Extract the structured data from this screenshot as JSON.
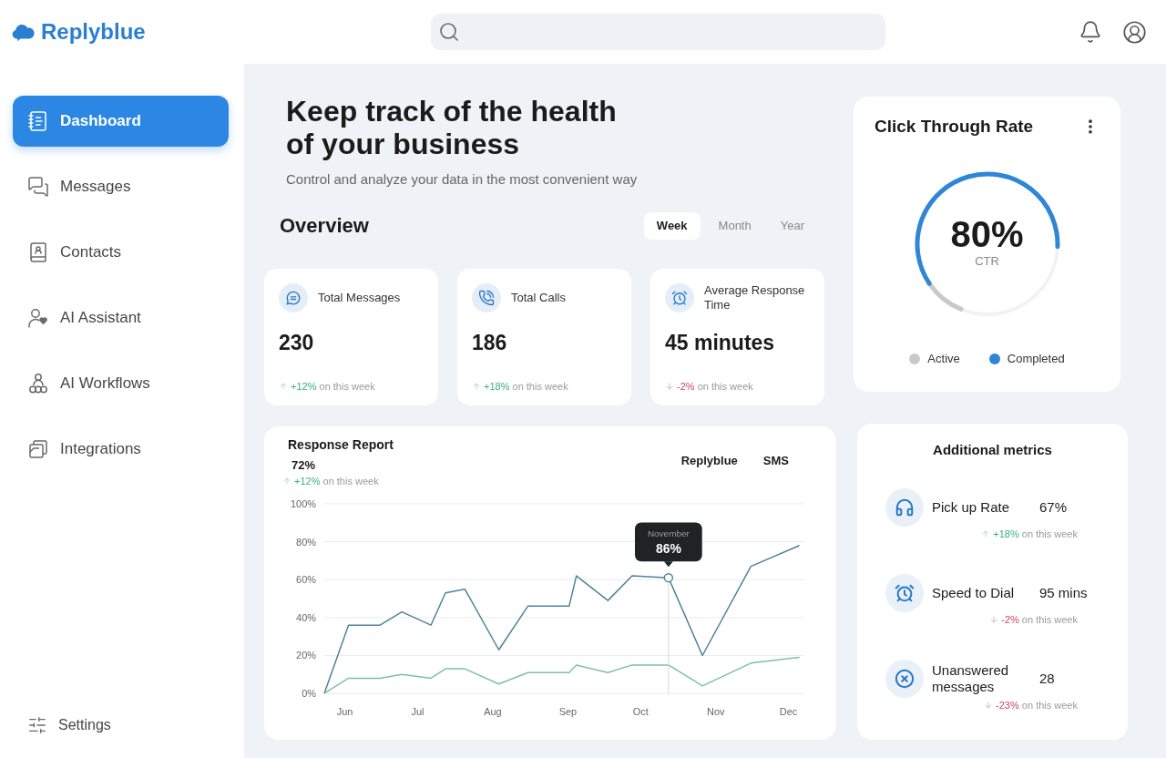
{
  "header": {
    "brand": "Replyblue"
  },
  "sidebar": {
    "items": [
      {
        "label": "Dashboard",
        "selected": true
      },
      {
        "label": "Messages",
        "selected": false
      },
      {
        "label": "Contacts",
        "selected": false
      },
      {
        "label": "AI Assistant",
        "selected": false
      },
      {
        "label": "AI Workflows",
        "selected": false
      },
      {
        "label": "Integrations",
        "selected": false
      }
    ],
    "footer_item": {
      "label": "Settings"
    }
  },
  "hero": {
    "title": "Keep track of the health of your business",
    "subtitle": "Control and analyze your data in the most convenient way"
  },
  "overview": {
    "title": "Overview",
    "tabs": [
      {
        "label": "Week",
        "selected": true
      },
      {
        "label": "Month",
        "selected": false
      },
      {
        "label": "Year",
        "selected": false
      }
    ],
    "stats": [
      {
        "title": "Total Messages",
        "value": "230",
        "change": {
          "positive": true,
          "value": "+12%",
          "note": "on this week"
        }
      },
      {
        "title": "Total Calls",
        "value": "186",
        "change": {
          "positive": true,
          "value": "+18%",
          "note": "on this week"
        }
      },
      {
        "title": "Average Response Time",
        "value": "45 minutes",
        "change": {
          "positive": false,
          "value": "-2%",
          "note": "on this week"
        }
      }
    ]
  },
  "response_report": {
    "title": "Response Report",
    "value": "72%",
    "change": {
      "positive": true,
      "value": "+12%",
      "note": "on this week"
    },
    "chart_data": {
      "type": "line",
      "x": [
        "--05-22",
        "--06-01",
        "--06-14",
        "--06-23",
        "--07-05",
        "--07-11",
        "--07-19",
        "--08-02",
        "--08-14",
        "--08-31",
        "--09-03",
        "--09-16",
        "--09-26",
        "--10-11",
        "--10-25",
        "--11-14",
        "--12-04"
      ],
      "series": [
        {
          "name": "Replyblue",
          "color": "#4f8398",
          "values": [
            0,
            36,
            36,
            43,
            36,
            53,
            55,
            23,
            46,
            46,
            62,
            49,
            62,
            61,
            20,
            67,
            78
          ]
        },
        {
          "name": "SMS",
          "color": "#7dbfae",
          "values": [
            0,
            8,
            8,
            10,
            8,
            13,
            13,
            5,
            11,
            11,
            15,
            11,
            15,
            15,
            4,
            16,
            19
          ]
        }
      ],
      "xlim": [
        "--05-22",
        "--12-06"
      ],
      "ylim": [
        0,
        100
      ],
      "xticks": [
        {
          "value": "--06-01",
          "label": "Jun"
        },
        {
          "value": "--07-01",
          "label": "Jul"
        },
        {
          "value": "--08-01",
          "label": "Aug"
        },
        {
          "value": "--09-01",
          "label": "Sep"
        },
        {
          "value": "--10-01",
          "label": "Oct"
        },
        {
          "value": "--11-01",
          "label": "Nov"
        },
        {
          "value": "--12-01",
          "label": "Dec"
        }
      ],
      "yticks": [
        {
          "value": 0,
          "label": "0%"
        },
        {
          "value": 20,
          "label": "20%"
        },
        {
          "value": 40,
          "label": "40%"
        },
        {
          "value": 60,
          "label": "60%"
        },
        {
          "value": 80,
          "label": "80%"
        },
        {
          "value": 100,
          "label": "100%"
        }
      ],
      "grid": true,
      "ref_lines": [
        {
          "axis": "x",
          "value": "--10-11",
          "color": "#d6d6d6"
        }
      ],
      "annotations": [
        "November",
        "86%"
      ]
    }
  },
  "click_through_rate": {
    "title": "Click Through Rate",
    "value": "80%",
    "caption": "CTR",
    "legend": [
      {
        "label": "Active",
        "color": "#c9c9c9"
      },
      {
        "label": "Completed",
        "color": "#2f86d6"
      }
    ]
  },
  "additional_metrics": {
    "title": "Additional metrics",
    "items": [
      {
        "label": "Pick up Rate",
        "value": "67%",
        "change": {
          "positive": true,
          "value": "+18%",
          "note": "on this week"
        }
      },
      {
        "label": "Speed to Dial",
        "value": "95 mins",
        "change": {
          "positive": false,
          "value": "-2%",
          "note": "on this week"
        }
      },
      {
        "label": "Unanswered messages",
        "value": "28",
        "change": {
          "positive": false,
          "value": "-23%",
          "note": "on this week"
        }
      }
    ]
  }
}
